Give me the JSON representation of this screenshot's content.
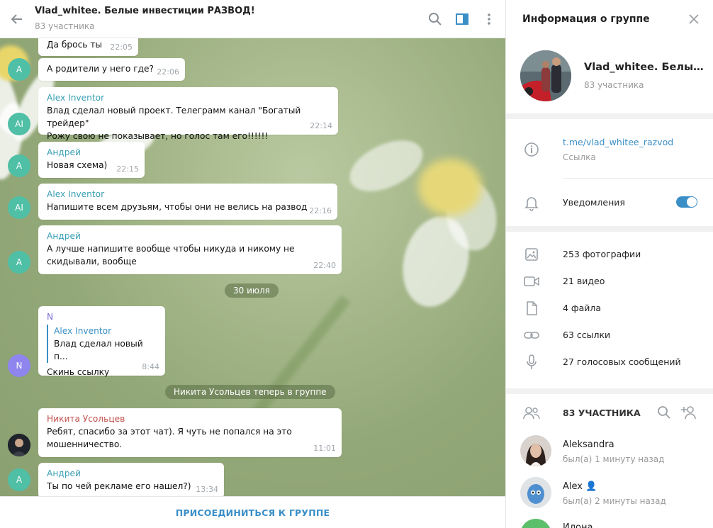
{
  "colors": {
    "accent": "#3a8fc7",
    "green_avatar": "#4fbfa5",
    "purple_avatar": "#8e85ee"
  },
  "chat_header": {
    "title": "Vlad_whitee. Белые инвестиции РАЗВОД!",
    "subtitle": "83 участника",
    "icons": [
      "back-arrow-icon",
      "search-icon",
      "sidebar-icon",
      "more-icon"
    ]
  },
  "messages": [
    {
      "author": "",
      "text": [
        "Да брось ты"
      ],
      "time": "22:05",
      "avatar": ""
    },
    {
      "author": "",
      "text": [
        "А родители у него где?"
      ],
      "time": "22:06",
      "avatar": "А"
    },
    {
      "author": "Alex Inventor",
      "text": [
        "Влад сделал новый проект. Телеграмм канал \"Богатый трейдер\"",
        "Рожу свою не показывает, но голос там его!!!!!!"
      ],
      "time": "22:14",
      "avatar": "AI"
    },
    {
      "author": "Андрей",
      "text": [
        "Новая схема)"
      ],
      "time": "22:15",
      "avatar": "А"
    },
    {
      "author": "Alex Inventor",
      "text": [
        "Напишите всем друзьям, чтобы они не велись на развод"
      ],
      "time": "22:16",
      "avatar": "AI"
    },
    {
      "author": "Андрей",
      "text": [
        "А лучше напишите вообще чтобы никуда и никому не",
        "скидывали, вообще"
      ],
      "time": "22:40",
      "avatar": "А"
    },
    {
      "author": "N",
      "quote_author": "Alex Inventor",
      "quote_text": "Влад сделал новый п...",
      "text": [
        "Скинь ссылку"
      ],
      "time": "8:44",
      "avatar": "N"
    },
    {
      "author": "Никита Усольцев",
      "text": [
        "Ребят, спасибо за этот чат). Я чуть не попался на это",
        "мошенничество."
      ],
      "time": "11:01",
      "avatar": ""
    },
    {
      "author": "Андрей",
      "text": [
        "Ты по чей рекламе его нашел?)"
      ],
      "time": "13:34",
      "avatar": "А"
    }
  ],
  "date_pill": "30 июля",
  "service_message": "Никита Усольцев теперь в группе",
  "join_button": "ПРИСОЕДИНИТЬСЯ К ГРУППЕ",
  "info": {
    "title": "Информация о группе",
    "group_name": "Vlad_whitee. Белые инвестиции РАЗВОД!",
    "members_count": "83 участника",
    "link": "t.me/vlad_whitee_razvod",
    "link_label": "Ссылка",
    "notifications_label": "Уведомления",
    "notifications_on": true,
    "media": [
      {
        "icon": "photo-icon",
        "label": "253 фотографии"
      },
      {
        "icon": "video-icon",
        "label": "21 видео"
      },
      {
        "icon": "file-icon",
        "label": "4 файла"
      },
      {
        "icon": "link-icon",
        "label": "63 ссылки"
      },
      {
        "icon": "mic-icon",
        "label": "27 голосовых сообщений"
      }
    ],
    "members_header": "83 УЧАСТНИКА",
    "members": [
      {
        "name": "Aleksandra",
        "status": "был(а) 1 минуту назад"
      },
      {
        "name": "Alex 👤",
        "status": "был(а) 2 минуты назад"
      },
      {
        "name": "Илона",
        "status": ""
      }
    ]
  }
}
